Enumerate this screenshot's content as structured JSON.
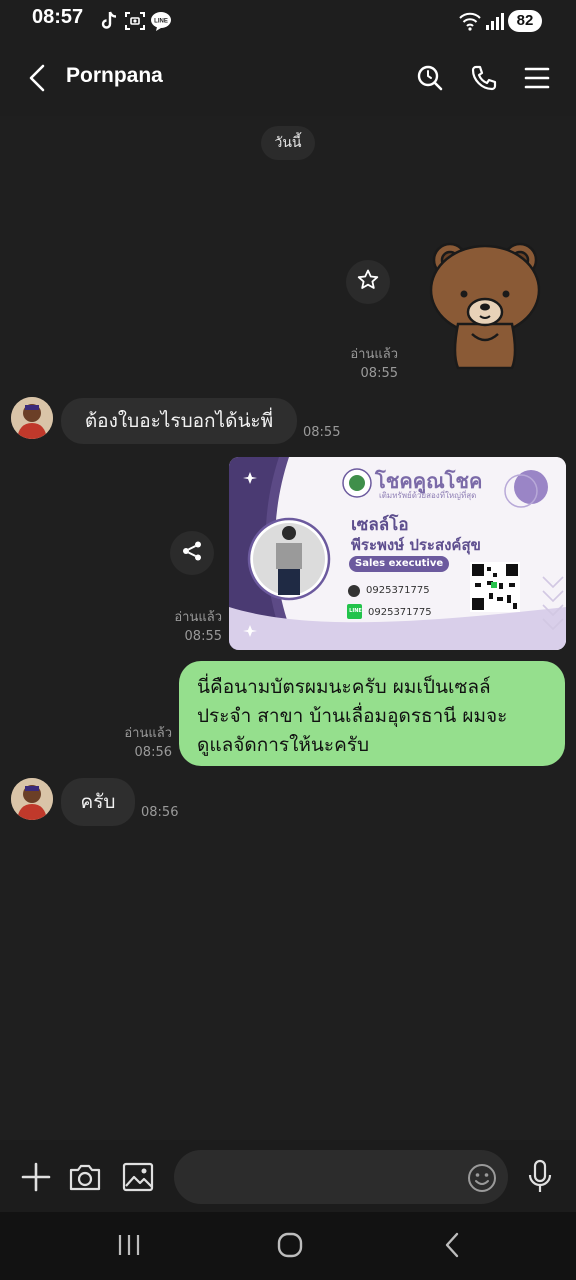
{
  "status_bar": {
    "time": "08:57",
    "battery": "82",
    "icons": [
      "tiktok-icon",
      "screenshot-icon",
      "line-app-icon",
      "wifi-icon",
      "signal-icon"
    ]
  },
  "header": {
    "contact_name": "Pornpana",
    "icons": [
      "back-arrow-icon",
      "search-icon",
      "phone-icon",
      "menu-icon"
    ]
  },
  "date_separator": "วันนี้",
  "messages": {
    "sticker": {
      "read_label": "อ่านแล้ว",
      "time": "08:55"
    },
    "msg1": {
      "text": "ต้องใบอะไรบอกได้น่ะพี่",
      "time": "08:55"
    },
    "card_image": {
      "read_label": "อ่านแล้ว",
      "time": "08:55",
      "brand": "โชคคูณโชค",
      "tagline": "เติมทรัพย์ด้วยสองที่ใหญ่ที่สุด",
      "nickname": "เซลล์โอ",
      "full_name": "พีระพงษ์ ประสงค์สุข",
      "role": "Sales executive",
      "phone": "0925371775",
      "line_id": "0925371775",
      "line_badge": "LINE"
    },
    "msg2": {
      "read_label": "อ่านแล้ว",
      "time": "08:56",
      "lines": [
        "นี่คือนามบัตรผมนะครับ ผมเป็นเซลล์",
        "ประจำ สาขา บ้านเลื่อมอุดรธานี ผมจะ",
        "ดูแลจัดการให้นะครับ"
      ]
    },
    "msg3": {
      "text": "ครับ",
      "time": "08:56"
    }
  },
  "input_bar": {
    "icons": [
      "plus-icon",
      "camera-icon",
      "image-icon",
      "emoji-icon",
      "microphone-icon"
    ]
  },
  "nav_bar": {
    "icons": [
      "recent-apps-icon",
      "home-icon",
      "back-icon"
    ]
  },
  "colors": {
    "background": "#1f1f1f",
    "outgoing_bubble": "#95df8d",
    "incoming_bubble": "#2e2e2e",
    "card_accent": "#6c5a9e"
  }
}
